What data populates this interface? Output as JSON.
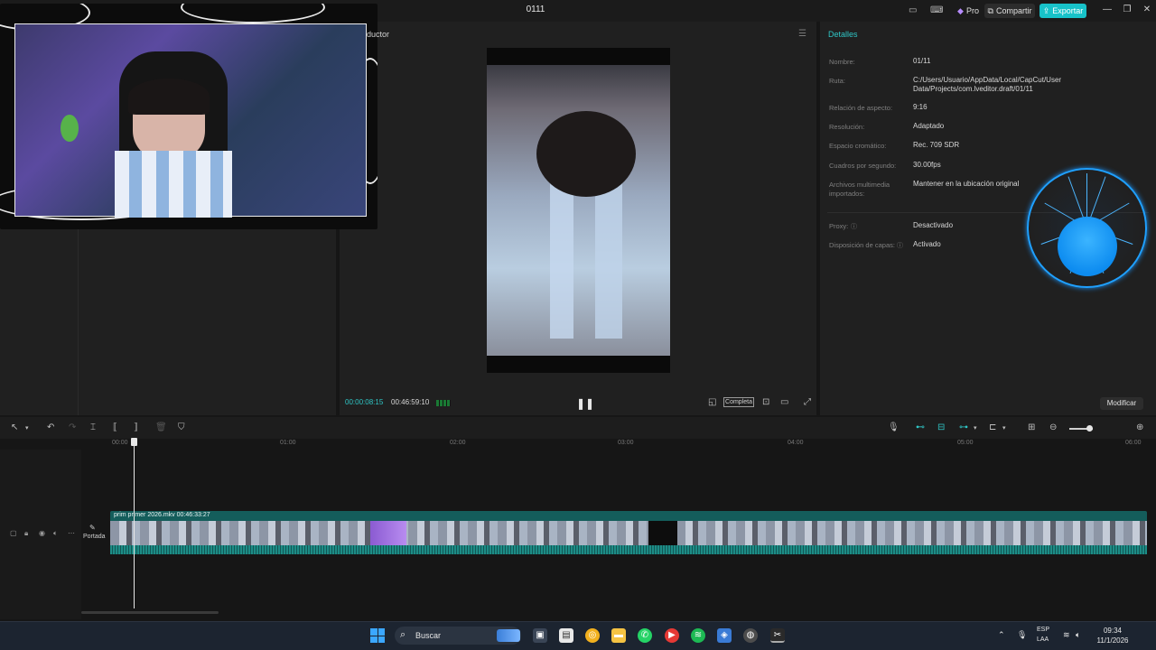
{
  "window": {
    "title": "0111",
    "pro_label": "Pro",
    "share_label": "Compartir",
    "export_label": "Exportar",
    "minimize": "—",
    "maximize": "❐",
    "close": "✕"
  },
  "player": {
    "label": "ductor",
    "time_current": "00:00:08:15",
    "time_total": "00:46:59:10",
    "complete_label": "Completa"
  },
  "details": {
    "title": "Detalles",
    "rows": [
      {
        "label": "Nombre:",
        "value": "01/11"
      },
      {
        "label": "Ruta:",
        "value": "C:/Users/Usuario/AppData/Local/CapCut/User Data/Projects/com.lveditor.draft/01/11"
      },
      {
        "label": "Relación de aspecto:",
        "value": "9:16"
      },
      {
        "label": "Resolución:",
        "value": "Adaptado"
      },
      {
        "label": "Espacio cromático:",
        "value": "Rec. 709 SDR"
      },
      {
        "label": "Cuadros por segundo:",
        "value": "30.00fps"
      },
      {
        "label": "Archivos multimedia importados:",
        "value": "Mantener en la ubicación original"
      },
      {
        "label": "Proxy:",
        "value": "Desactivado"
      },
      {
        "label": "Disposición de capas:",
        "value": "Activado"
      }
    ],
    "modify_label": "Modificar"
  },
  "timeline": {
    "ruler": [
      "00:00",
      "01:00",
      "02:00",
      "03:00",
      "04:00",
      "05:00",
      "06:00"
    ],
    "clip_label": "prim  primer 2026.mkv   00:46:33:27",
    "cover_label": "Portada"
  },
  "taskbar": {
    "search_label": "Buscar",
    "lang_top": "ESP",
    "lang_bottom": "LAA",
    "time": "09:34",
    "date": "11/1/2026"
  }
}
